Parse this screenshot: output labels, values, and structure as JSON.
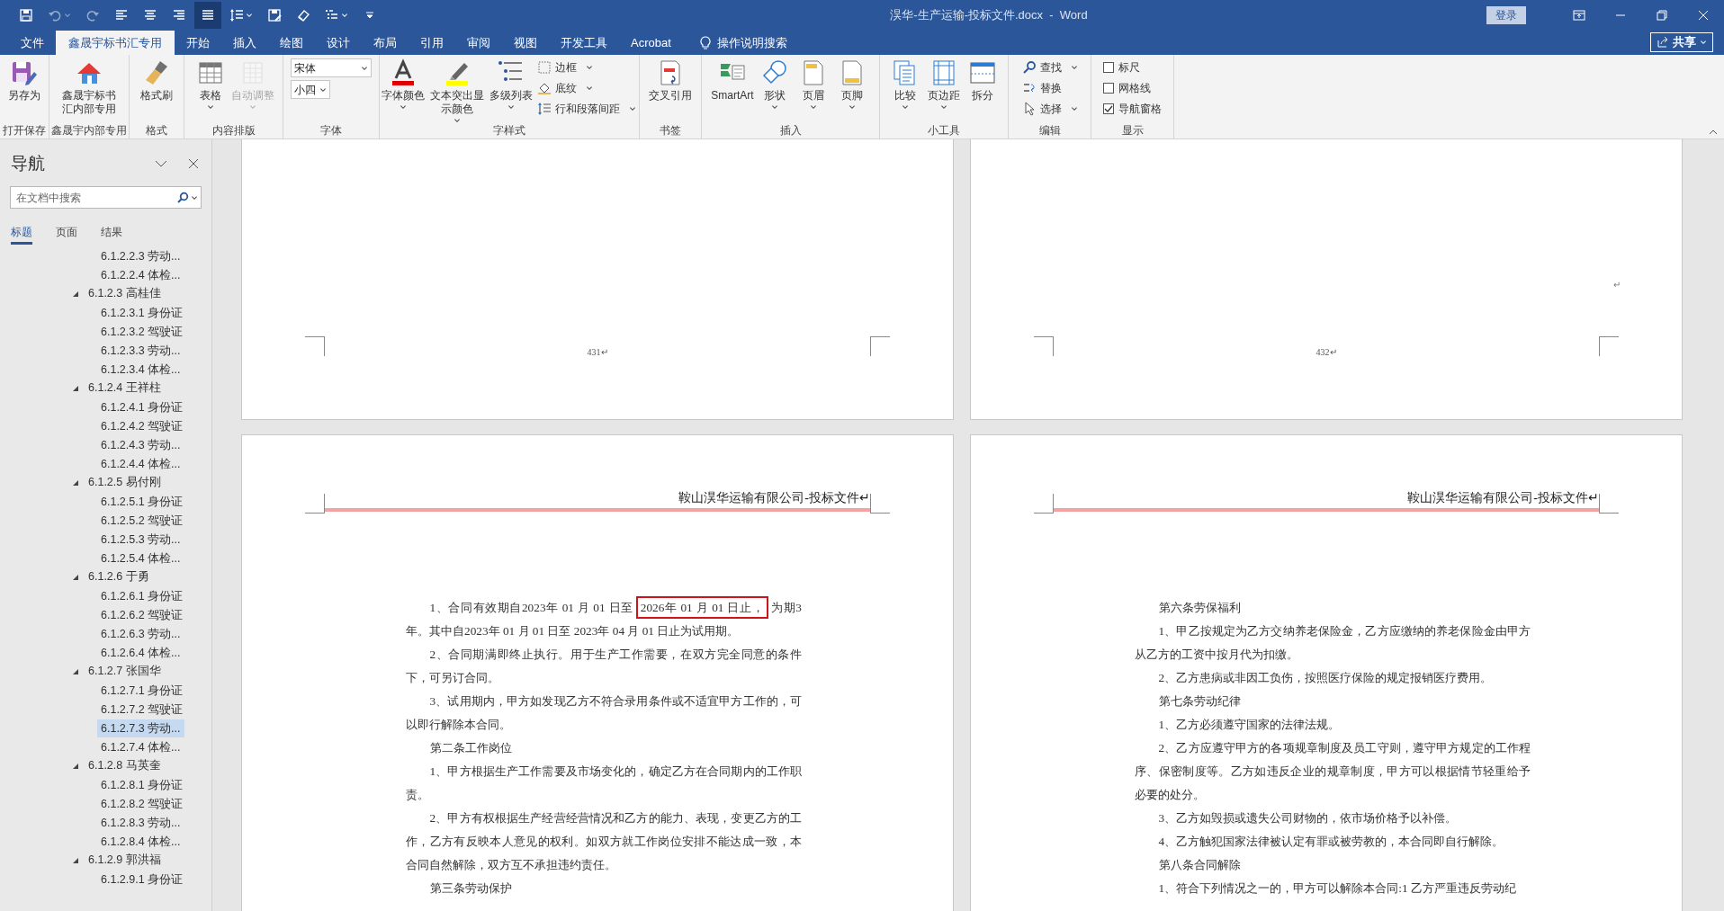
{
  "title_bar": {
    "title": "淏华-生产运输-投标文件.docx  -  Word",
    "sign_in": "登录"
  },
  "quick_access": [
    {
      "kind": "save"
    },
    {
      "kind": "undo",
      "disabled": true
    },
    {
      "kind": "redo",
      "disabled": true
    },
    {
      "kind": "align_left",
      "selected": false
    },
    {
      "kind": "align_center",
      "selected": false
    },
    {
      "kind": "align_right",
      "selected": false
    },
    {
      "kind": "justify",
      "selected": true
    },
    {
      "kind": "line_spacing"
    },
    {
      "kind": "save_pdf"
    },
    {
      "kind": "eraser"
    },
    {
      "kind": "list"
    },
    {
      "kind": "customize"
    }
  ],
  "tabs": [
    {
      "label": "文件",
      "selected": false
    },
    {
      "label": "鑫晟宇标书汇专用",
      "selected": true
    },
    {
      "label": "开始",
      "selected": false
    },
    {
      "label": "插入",
      "selected": false
    },
    {
      "label": "绘图",
      "selected": false
    },
    {
      "label": "设计",
      "selected": false
    },
    {
      "label": "布局",
      "selected": false
    },
    {
      "label": "引用",
      "selected": false
    },
    {
      "label": "审阅",
      "selected": false
    },
    {
      "label": "视图",
      "selected": false
    },
    {
      "label": "开发工具",
      "selected": false
    },
    {
      "label": "Acrobat",
      "selected": false
    }
  ],
  "tell_me": "操作说明搜索",
  "share": "共享",
  "ribbon": {
    "groups": [
      {
        "label": "打开保存",
        "controls": [
          {
            "kind": "large",
            "label": "另存为"
          }
        ]
      },
      {
        "label": "鑫晟宇内部专用",
        "controls": [
          {
            "kind": "large",
            "label": "鑫晟宇标书汇内部专用"
          }
        ]
      },
      {
        "label": "格式",
        "controls": [
          {
            "kind": "large",
            "label": "格式刷"
          }
        ]
      },
      {
        "label": "内容排版",
        "controls": [
          {
            "kind": "large",
            "label": "表格",
            "caret": true
          },
          {
            "kind": "large",
            "label": "自动调整",
            "caret": true,
            "disabled": true
          }
        ]
      },
      {
        "label": "字体",
        "controls": [
          {
            "kind": "dropdown",
            "value": "宋体"
          },
          {
            "kind": "dropdown",
            "value": "小四"
          }
        ]
      },
      {
        "label": "字样式",
        "controls": [
          {
            "kind": "large",
            "label": "字体颜色",
            "caret": true
          },
          {
            "kind": "large",
            "label": "文本突出显示颜色",
            "caret": true
          },
          {
            "kind": "large",
            "label": "多级列表",
            "caret": true
          },
          {
            "kind": "small",
            "label": "边框",
            "caret": true
          },
          {
            "kind": "small",
            "label": "底纹",
            "caret": true
          },
          {
            "kind": "small",
            "label": "行和段落间距",
            "caret": true
          }
        ]
      },
      {
        "label": "书签",
        "controls": [
          {
            "kind": "large",
            "label": "交叉引用"
          }
        ]
      },
      {
        "label": "插入",
        "controls": [
          {
            "kind": "large",
            "label": "SmartArt"
          },
          {
            "kind": "large",
            "label": "形状",
            "caret": true
          },
          {
            "kind": "large",
            "label": "页眉",
            "caret": true
          },
          {
            "kind": "large",
            "label": "页脚",
            "caret": true
          }
        ]
      },
      {
        "label": "小工具",
        "controls": [
          {
            "kind": "large",
            "label": "比较",
            "caret": true
          },
          {
            "kind": "large",
            "label": "页边距",
            "caret": true
          },
          {
            "kind": "large",
            "label": "拆分"
          }
        ]
      },
      {
        "label": "编辑",
        "controls": [
          {
            "kind": "small",
            "label": "查找",
            "caret": true
          },
          {
            "kind": "small",
            "label": "替换"
          },
          {
            "kind": "small",
            "label": "选择",
            "caret": true
          }
        ]
      },
      {
        "label": "显示",
        "controls": [
          {
            "kind": "checkbox",
            "label": "标尺",
            "checked": false
          },
          {
            "kind": "checkbox",
            "label": "网格线",
            "checked": false
          },
          {
            "kind": "checkbox",
            "label": "导航窗格",
            "checked": true
          }
        ]
      }
    ]
  },
  "navigation": {
    "title": "导航",
    "search": {
      "placeholder": "在文档中搜索"
    },
    "tabs": [
      {
        "label": "标题",
        "selected": true
      },
      {
        "label": "页面",
        "selected": false
      },
      {
        "label": "结果",
        "selected": false
      }
    ],
    "tree": [
      {
        "children": [
          {
            "label": "6.1.2.2.3 劳动...",
            "selected": false
          },
          {
            "label": "6.1.2.2.4 体检...",
            "selected": false
          }
        ]
      },
      {
        "label": "6.1.2.3 高桂佳",
        "expanded": true,
        "children": [
          {
            "label": "6.1.2.3.1 身份证",
            "selected": false
          },
          {
            "label": "6.1.2.3.2 驾驶证",
            "selected": false
          },
          {
            "label": "6.1.2.3.3 劳动...",
            "selected": false
          },
          {
            "label": "6.1.2.3.4 体检...",
            "selected": false
          }
        ]
      },
      {
        "label": "6.1.2.4 王祥柱",
        "expanded": true,
        "children": [
          {
            "label": "6.1.2.4.1 身份证",
            "selected": false
          },
          {
            "label": "6.1.2.4.2 驾驶证",
            "selected": false
          },
          {
            "label": "6.1.2.4.3 劳动...",
            "selected": false
          },
          {
            "label": "6.1.2.4.4 体检...",
            "selected": false
          }
        ]
      },
      {
        "label": "6.1.2.5 易付刚",
        "expanded": true,
        "children": [
          {
            "label": "6.1.2.5.1 身份证",
            "selected": false
          },
          {
            "label": "6.1.2.5.2 驾驶证",
            "selected": false
          },
          {
            "label": "6.1.2.5.3 劳动...",
            "selected": false
          },
          {
            "label": "6.1.2.5.4 体检...",
            "selected": false
          }
        ]
      },
      {
        "label": "6.1.2.6 于勇",
        "expanded": true,
        "children": [
          {
            "label": "6.1.2.6.1 身份证",
            "selected": false
          },
          {
            "label": "6.1.2.6.2 驾驶证",
            "selected": false
          },
          {
            "label": "6.1.2.6.3 劳动...",
            "selected": false
          },
          {
            "label": "6.1.2.6.4 体检...",
            "selected": false
          }
        ]
      },
      {
        "label": "6.1.2.7 张国华",
        "expanded": true,
        "children": [
          {
            "label": "6.1.2.7.1 身份证",
            "selected": false
          },
          {
            "label": "6.1.2.7.2 驾驶证",
            "selected": false
          },
          {
            "label": "6.1.2.7.3 劳动...",
            "selected": true
          },
          {
            "label": "6.1.2.7.4 体检...",
            "selected": false
          }
        ]
      },
      {
        "label": "6.1.2.8 马英奎",
        "expanded": true,
        "children": [
          {
            "label": "6.1.2.8.1 身份证",
            "selected": false
          },
          {
            "label": "6.1.2.8.2 驾驶证",
            "selected": false
          },
          {
            "label": "6.1.2.8.3 劳动...",
            "selected": false
          },
          {
            "label": "6.1.2.8.4 体检...",
            "selected": false
          }
        ]
      },
      {
        "label": "6.1.2.9 郭洪福",
        "expanded": true,
        "children": [
          {
            "label": "6.1.2.9.1 身份证",
            "selected": false
          }
        ]
      }
    ]
  },
  "pages": [
    {
      "kind": "page_end",
      "page_number": "431↵"
    },
    {
      "kind": "page_end",
      "page_number": "432↵",
      "mark": "↵"
    },
    {
      "kind": "content",
      "header": "鞍山淏华运输有限公司-投标文件↵",
      "paragraphs": [
        {
          "segments": [
            {
              "text": "1、合同有效期自2023年 01 月 01 日至"
            },
            {
              "text": "2026年 01 月 01 日止，",
              "boxed": true
            },
            {
              "text": "为期3年。其中自2023年 01 月 01 日至 2023年 04 月 01 日止为试用期。"
            }
          ]
        },
        {
          "text": "2、合同期满即终止执行。用于生产工作需要，在双方完全同意的条件下，可另订合同。"
        },
        {
          "text": "3、试用期内，甲方如发现乙方不符合录用条件或不适宜甲方工作的，可以即行解除本合同。"
        },
        {
          "text": "第二条工作岗位"
        },
        {
          "text": "1、甲方根据生产工作需要及市场变化的，确定乙方在合同期内的工作职责。"
        },
        {
          "text": "2、甲方有权根据生产经营经营情况和乙方的能力、表现，变更乙方的工作，乙方有反映本人意见的权利。如双方就工作岗位安排不能达成一致，本合同自然解除，双方互不承担违约责任。"
        },
        {
          "text": "第三条劳动保护"
        }
      ]
    },
    {
      "kind": "content",
      "header": "鞍山淏华运输有限公司-投标文件↵",
      "paragraphs": [
        {
          "text": "第六条劳保福利"
        },
        {
          "text": "1、甲乙按规定为乙方交纳养老保险金，乙方应缴纳的养老保险金由甲方从乙方的工资中按月代为扣缴。"
        },
        {
          "text": "2、乙方患病或非因工负伤，按照医疗保险的规定报销医疗费用。"
        },
        {
          "text": "第七条劳动纪律"
        },
        {
          "text": "1、乙方必须遵守国家的法律法规。"
        },
        {
          "text": "2、乙方应遵守甲方的各项规章制度及员工守则，遵守甲方规定的工作程序、保密制度等。乙方如违反企业的规章制度，甲方可以根据情节轻重给予必要的处分。"
        },
        {
          "text": "3、乙方如毁损或遗失公司财物的，依市场价格予以补偿。"
        },
        {
          "text": "4、乙方触犯国家法律被认定有罪或被劳教的，本合同即自行解除。"
        },
        {
          "text": "第八条合同解除"
        },
        {
          "text": "1、符合下列情况之一的，甲方可以解除本合同:1 乙方严重违反劳动纪"
        }
      ]
    }
  ]
}
